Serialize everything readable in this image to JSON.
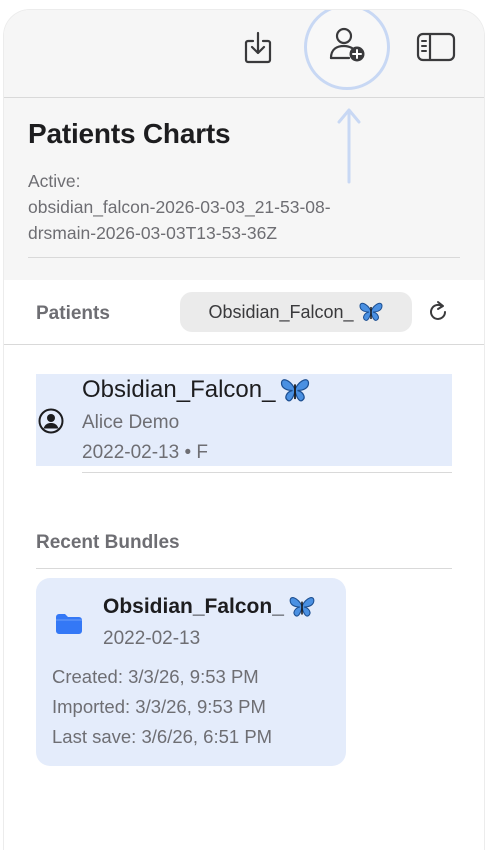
{
  "toolbar": {
    "download_icon": "tray-arrow-down-icon",
    "add_patient_icon": "person-add-icon",
    "sidebar_icon": "sidebar-toggle-icon"
  },
  "header": {
    "title": "Patients Charts",
    "active_label": "Active:",
    "active_line1": "obsidian_falcon-2026-03-03_21-53-08-",
    "active_line2": "drsmain-2026-03-03T13-53-36Z"
  },
  "patients_section": {
    "label": "Patients",
    "selected_chip": "Obsidian_Falcon_",
    "refresh_icon": "refresh-icon"
  },
  "patients": [
    {
      "name": "Obsidian_Falcon_",
      "subtitle": "Alice Demo",
      "details": "2022-02-13 • F"
    }
  ],
  "recent_bundles": {
    "label": "Recent Bundles",
    "items": [
      {
        "name": "Obsidian_Falcon_",
        "date": "2022-02-13",
        "created": "Created: 3/3/26, 9:53 PM",
        "imported": "Imported: 3/3/26, 9:53 PM",
        "last_save": "Last save: 3/6/26, 6:51 PM"
      }
    ]
  },
  "colors": {
    "accent": "#3478f6",
    "selection_bg": "#e4ecfb",
    "highlight_ring": "#c8d8f4"
  }
}
